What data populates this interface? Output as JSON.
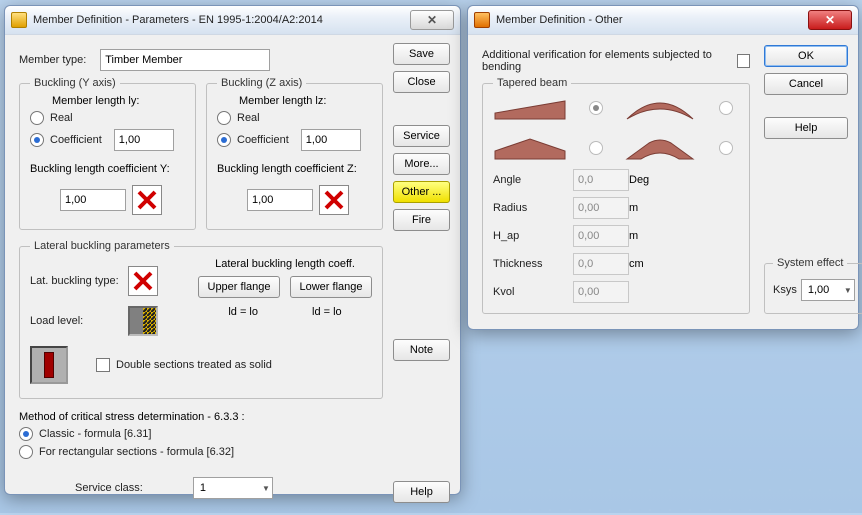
{
  "dialog1": {
    "title": "Member Definition - Parameters - EN 1995-1:2004/A2:2014",
    "member_type_label": "Member type:",
    "member_type_value": "Timber Member",
    "buckling_y": {
      "legend": "Buckling (Y axis)",
      "mem_len_label": "Member length ly:",
      "real_label": "Real",
      "coef_label": "Coefficient",
      "coef_value": "1,00",
      "blc_label": "Buckling length coefficient Y:",
      "blc_value": "1,00"
    },
    "buckling_z": {
      "legend": "Buckling (Z axis)",
      "mem_len_label": "Member length lz:",
      "real_label": "Real",
      "coef_label": "Coefficient",
      "coef_value": "1,00",
      "blc_label": "Buckling length coefficient Z:",
      "blc_value": "1,00"
    },
    "lateral": {
      "legend": "Lateral buckling parameters",
      "lat_type_label": "Lat. buckling type:",
      "coeff_label": "Lateral buckling length coeff.",
      "upper_flange": "Upper flange",
      "lower_flange": "Lower flange",
      "load_level_label": "Load level:",
      "ld_lo_1": "ld = lo",
      "ld_lo_2": "ld = lo",
      "double_sections": "Double sections treated as solid"
    },
    "method": {
      "heading": "Method of critical stress determination - 6.3.3 :",
      "classic": "Classic - formula [6.31]",
      "rect": "For rectangular sections - formula [6.32]"
    },
    "service_class_label": "Service class:",
    "service_class_value": "1",
    "buttons": {
      "save": "Save",
      "close": "Close",
      "service": "Service",
      "more": "More...",
      "other": "Other ...",
      "fire": "Fire",
      "note": "Note",
      "help": "Help"
    }
  },
  "dialog2": {
    "title": "Member Definition - Other",
    "subtitle": "Additional verification for elements subjected to bending",
    "tapered_legend": "Tapered beam",
    "angle_label": "Angle",
    "angle_value": "0,0",
    "angle_unit": "Deg",
    "radius_label": "Radius",
    "radius_value": "0,00",
    "radius_unit": "m",
    "hap_label": "H_ap",
    "hap_value": "0,00",
    "hap_unit": "m",
    "thickness_label": "Thickness",
    "thickness_value": "0,0",
    "thickness_unit": "cm",
    "kvol_label": "Kvol",
    "kvol_value": "0,00",
    "system_effect_legend": "System effect",
    "ksys_label": "Ksys",
    "ksys_value": "1,00",
    "buttons": {
      "ok": "OK",
      "cancel": "Cancel",
      "help": "Help"
    }
  }
}
